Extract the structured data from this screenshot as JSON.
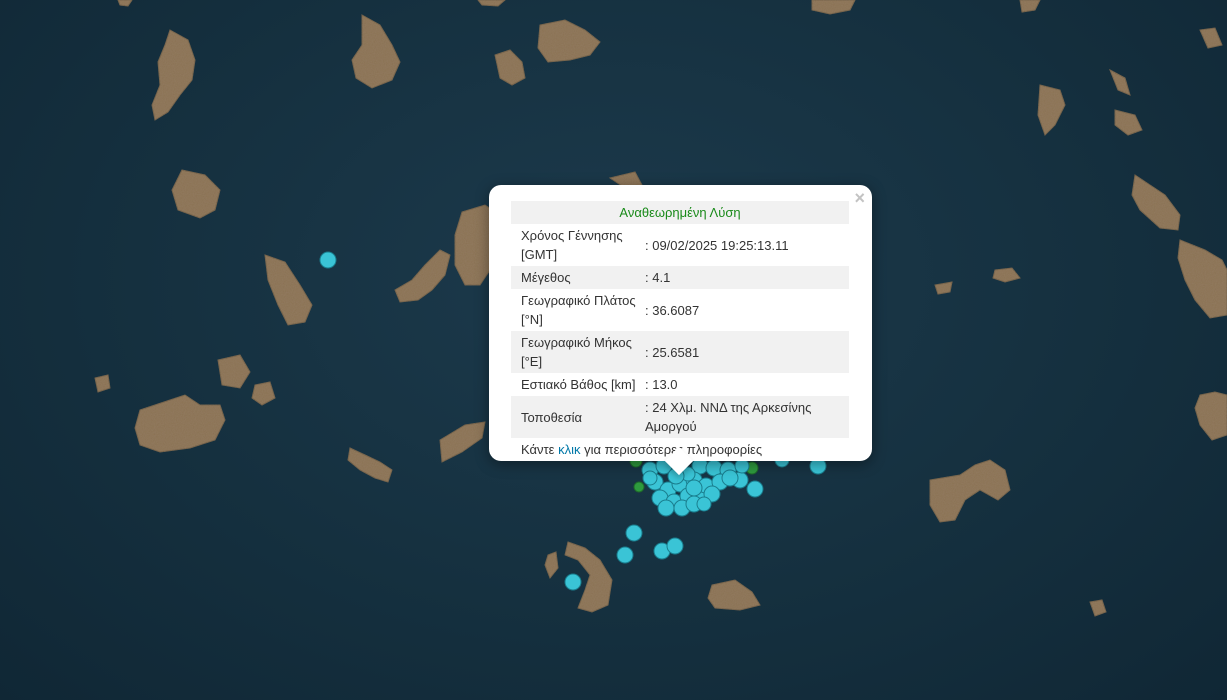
{
  "popup": {
    "header": "Αναθεωρημένη Λύση",
    "close_symbol": "×",
    "rows": [
      {
        "label": "Χρόνος Γέννησης [GMT]",
        "value": ": 09/02/2025 19:25:13.11"
      },
      {
        "label": "Μέγεθος",
        "value": ": 4.1"
      },
      {
        "label": "Γεωγραφικό Πλάτος [°N]",
        "value": ": 36.6087"
      },
      {
        "label": "Γεωγραφικό Μήκος [°E]",
        "value": ": 25.6581"
      },
      {
        "label": "Εστιακό Βάθος [km]",
        "value": ": 13.0"
      },
      {
        "label": "Τοποθεσία",
        "value": ": 24 Χλμ. ΝΝΔ της Αρκεσίνης Αμοργού"
      }
    ],
    "more_prefix": "Κάντε",
    "more_link": "κλικ",
    "more_suffix": "για περισσότερες πληροφορίες"
  },
  "colors": {
    "sea": "#15303f",
    "land": "#8a7152",
    "marker_cyan": "#3ac4d6",
    "marker_green": "#2e9a3e",
    "header_green": "#1a8a1a",
    "link_blue": "#0078a8"
  },
  "icons": {
    "close": "close-icon"
  }
}
